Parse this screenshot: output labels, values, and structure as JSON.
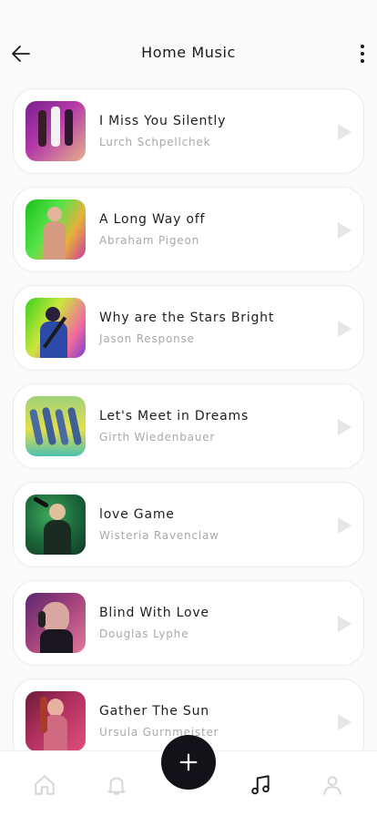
{
  "header": {
    "title": "Home Music"
  },
  "songs": [
    {
      "title": "I Miss You Silently",
      "artist": "Lurch Schpellchek"
    },
    {
      "title": "A Long Way off",
      "artist": "Abraham Pigeon"
    },
    {
      "title": "Why are the Stars Bright",
      "artist": "Jason Response"
    },
    {
      "title": "Let's Meet in Dreams",
      "artist": "Girth Wiedenbauer"
    },
    {
      "title": "love Game",
      "artist": "Wisteria Ravenclaw"
    },
    {
      "title": "Blind With Love",
      "artist": "Douglas Lyphe"
    },
    {
      "title": "Gather The Sun",
      "artist": "Ursula Gurnmeister"
    }
  ],
  "icons": {
    "back": "arrow-left-icon",
    "more": "more-vertical-icon",
    "play": "play-icon",
    "add": "plus-icon",
    "home": "home-icon",
    "notifications": "bell-icon",
    "music": "music-note-icon",
    "profile": "user-icon"
  },
  "colors": {
    "background": "#fafafa",
    "card": "#ffffff",
    "fab": "#121218",
    "title_text": "#1e1e1e",
    "artist_text": "#a9a9a9",
    "play_icon": "#e6e6e6",
    "nav_inactive": "#d6d6d6",
    "nav_active": "#1a1a1a"
  },
  "active_tab": "music"
}
